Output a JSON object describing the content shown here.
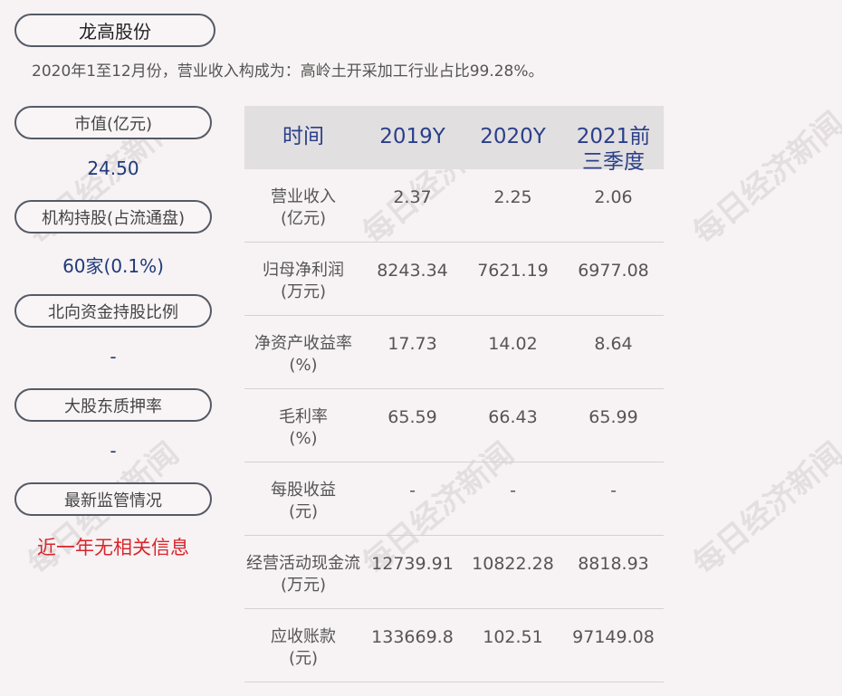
{
  "header": {
    "title": "龙高股份",
    "subtitle": "2020年1至12月份，营业收入构成为：高岭土开采加工行业占比99.28%。"
  },
  "left": [
    {
      "label": "市值(亿元)",
      "value": "24.50"
    },
    {
      "label": "机构持股(占流通盘)",
      "value": "60家(0.1%)"
    },
    {
      "label": "北向资金持股比例",
      "value": "-"
    },
    {
      "label": "大股东质押率",
      "value": "-"
    },
    {
      "label": "最新监管情况",
      "value": "近一年无相关信息"
    }
  ],
  "table": {
    "headers": [
      "时间",
      "2019Y",
      "2020Y",
      "2021前三季度"
    ],
    "rows": [
      {
        "label1": "营业收入",
        "label2": "(亿元)",
        "v": [
          "2.37",
          "2.25",
          "2.06"
        ]
      },
      {
        "label1": "归母净利润",
        "label2": "(万元)",
        "v": [
          "8243.34",
          "7621.19",
          "6977.08"
        ]
      },
      {
        "label1": "净资产收益率",
        "label2": "(%)",
        "v": [
          "17.73",
          "14.02",
          "8.64"
        ]
      },
      {
        "label1": "毛利率",
        "label2": "(%)",
        "v": [
          "65.59",
          "66.43",
          "65.99"
        ]
      },
      {
        "label1": "每股收益",
        "label2": "(元)",
        "v": [
          "-",
          "-",
          "-"
        ]
      },
      {
        "label1": "经营活动现金流",
        "label2": "(万元)",
        "v": [
          "12739.91",
          "10822.28",
          "8818.93"
        ]
      },
      {
        "label1": "应收账款",
        "label2": "(元)",
        "v": [
          "133669.8",
          "102.51",
          "97149.08"
        ]
      }
    ]
  },
  "watermark": "每日经济新闻",
  "colors": {
    "accent": "#1f3a7a",
    "header_text": "#2a3f8a",
    "warning": "#d8252c"
  }
}
